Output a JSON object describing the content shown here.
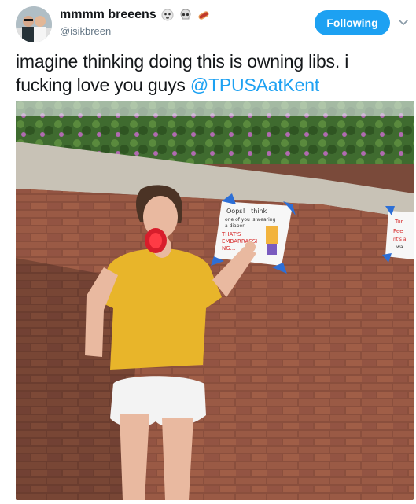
{
  "header": {
    "display_name": "mmmm breeens",
    "emojis": [
      "hear-no-evil-icon",
      "skull-icon",
      "hot-dog-icon"
    ],
    "handle": "@isikbreen",
    "follow_label": "Following"
  },
  "tweet": {
    "text": "imagine thinking doing this is owning libs. i fucking love you guys ",
    "mention": "@TPUSAatKent"
  },
  "media": {
    "sign_text": [
      "Oops! I think",
      "one of you is wearing",
      "a diaper",
      "THAT'S",
      "EMBARRASSI",
      "NG..."
    ],
    "sign2_text": [
      "Tur",
      "Pee",
      "nt's a",
      "wa"
    ]
  },
  "colors": {
    "accent": "#1da1f2",
    "text": "#14171a",
    "muted": "#657786"
  }
}
